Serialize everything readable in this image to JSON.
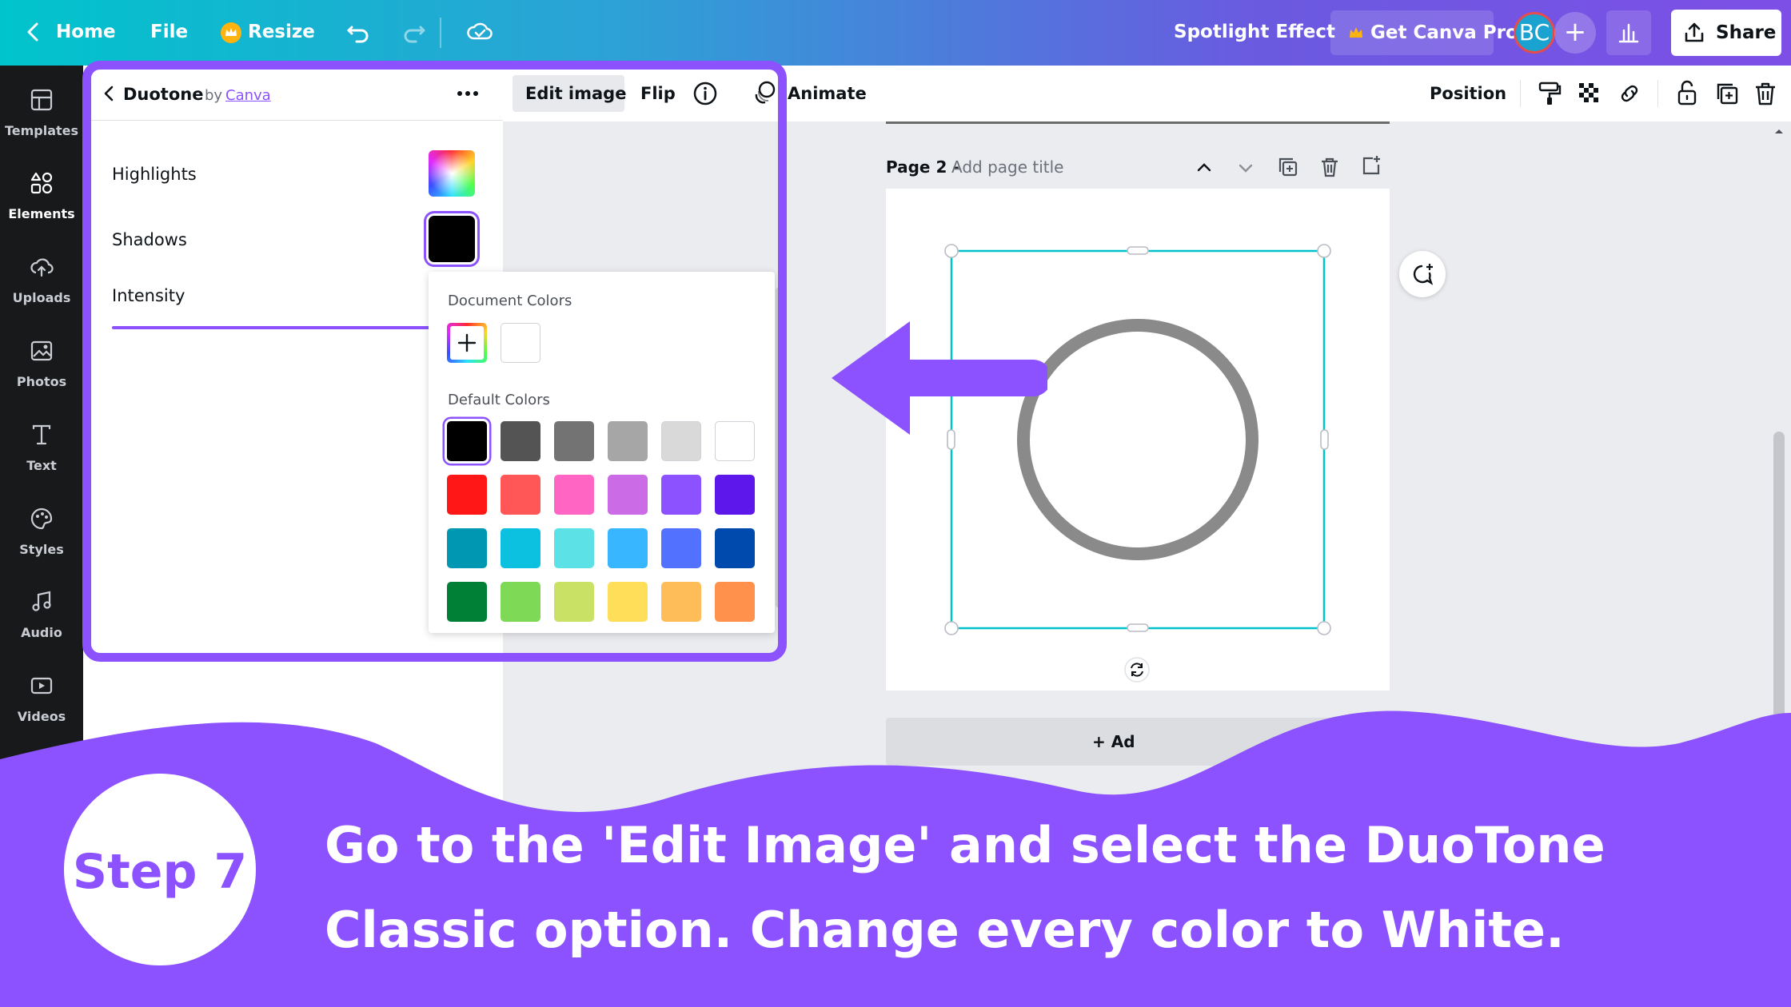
{
  "topbar": {
    "home": "Home",
    "file": "File",
    "resize": "Resize",
    "doc_title": "Spotlight Effect",
    "get_pro": "Get Canva Pro",
    "avatar_initials": "BC",
    "share": "Share"
  },
  "sidebar": {
    "items": [
      {
        "label": "Templates",
        "icon": "templates-icon"
      },
      {
        "label": "Elements",
        "icon": "elements-icon"
      },
      {
        "label": "Uploads",
        "icon": "uploads-icon"
      },
      {
        "label": "Photos",
        "icon": "photos-icon"
      },
      {
        "label": "Text",
        "icon": "text-icon"
      },
      {
        "label": "Styles",
        "icon": "styles-icon"
      },
      {
        "label": "Audio",
        "icon": "audio-icon"
      },
      {
        "label": "Videos",
        "icon": "videos-icon"
      }
    ]
  },
  "panel": {
    "title": "Duotone",
    "by": "by",
    "author": "Canva",
    "highlights_label": "Highlights",
    "shadows_label": "Shadows",
    "intensity_label": "Intensity"
  },
  "toolbar": {
    "edit_image": "Edit image",
    "flip": "Flip",
    "animate": "Animate",
    "position": "Position"
  },
  "color_picker": {
    "document_colors_title": "Document Colors",
    "default_colors_title": "Default Colors",
    "document_colors": [
      "#ffffff"
    ],
    "default_colors": [
      [
        "#000000",
        "#545454",
        "#737373",
        "#a6a6a6",
        "#d9d9d9",
        "#ffffff"
      ],
      [
        "#ff1616",
        "#ff5757",
        "#ff66c4",
        "#cb6ce6",
        "#8c52ff",
        "#5e17eb"
      ],
      [
        "#0097b2",
        "#0cc0df",
        "#5ce1e6",
        "#38b6ff",
        "#5271ff",
        "#004aad"
      ],
      [
        "#008037",
        "#7ed957",
        "#c9e265",
        "#ffde59",
        "#ffbd59",
        "#ff914d"
      ]
    ],
    "selected": "#000000"
  },
  "canvas": {
    "page_label": "Page 2 -",
    "page_title_placeholder": "Add page title",
    "add_page_partial": "+ Ad"
  },
  "tutorial": {
    "step": "Step 7",
    "line1": "Go to the 'Edit Image' and select the DuoTone",
    "line2": "Classic option. Change every color to White."
  },
  "colors": {
    "accent_purple": "#8c52ff",
    "selection_cyan": "#00c4cc",
    "sidebar_bg": "#18191b"
  }
}
